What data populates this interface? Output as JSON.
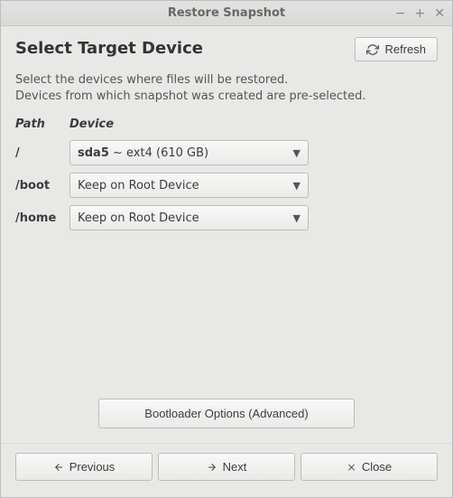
{
  "window": {
    "title": "Restore Snapshot"
  },
  "header": {
    "title": "Select Target Device",
    "refresh_label": "Refresh"
  },
  "description": {
    "line1": "Select the devices where files will be restored.",
    "line2": "Devices from which snapshot was created are pre-selected."
  },
  "columns": {
    "path": "Path",
    "device": "Device"
  },
  "rows": [
    {
      "path": "/",
      "device_html": "<strong>sda5</strong> ~ ext4 (610 GB)"
    },
    {
      "path": "/boot",
      "device_html": "Keep on Root Device"
    },
    {
      "path": "/home",
      "device_html": "Keep on Root Device"
    }
  ],
  "buttons": {
    "bootloader": "Bootloader Options (Advanced)",
    "previous": "Previous",
    "next": "Next",
    "close": "Close"
  }
}
